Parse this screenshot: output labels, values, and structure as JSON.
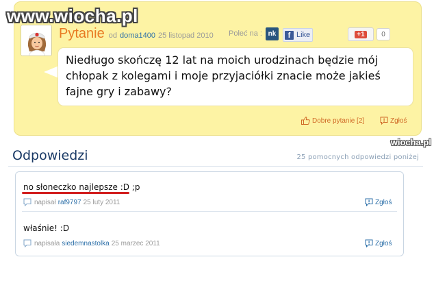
{
  "watermark": {
    "main": "www.wiocha.pl",
    "corner": "wiocha.pl"
  },
  "question": {
    "title": "Pytanie",
    "by_label": "od",
    "user": "doma1400",
    "date": "25 listopad 2010",
    "recommend_label": "Poleć na :",
    "nk_label": "nk",
    "fb_like_label": "Like",
    "gplus_label": "+1",
    "gplus_count": "0",
    "text": "Niedługo skończę 12 lat na moich urodzinach będzie mój chłopak z kolegami i moje przyjaciółki znacie może jakieś fajne gry i zabawy?",
    "good_question_label": "Dobre pytanie [2]",
    "report_label": "Zgłoś"
  },
  "answers": {
    "title": "Odpowiedzi",
    "count_text": "25 pomocnych odpowiedzi poniżej",
    "items": [
      {
        "text": "no słoneczko najlepsze :D ;p",
        "wrote_label": "napisał",
        "user": "raf9797",
        "date": "25 luty 2011",
        "report_label": "Zgłoś"
      },
      {
        "text": "właśnie! :D",
        "wrote_label": "napisała",
        "user": "siedemnastolka",
        "date": "25 marzec 2011",
        "report_label": "Zgłoś"
      }
    ]
  },
  "colors": {
    "question_bg": "#fdf3a4",
    "title_orange": "#e87a22",
    "link_blue": "#2c6fa8",
    "heading_navy": "#1a3a66",
    "highlight_red": "#d21f1f"
  },
  "icons": [
    "avatar-girl-nurse",
    "nk-icon",
    "facebook-icon",
    "google-plus-icon",
    "thumbs-up-icon",
    "report-icon",
    "comment-icon"
  ]
}
